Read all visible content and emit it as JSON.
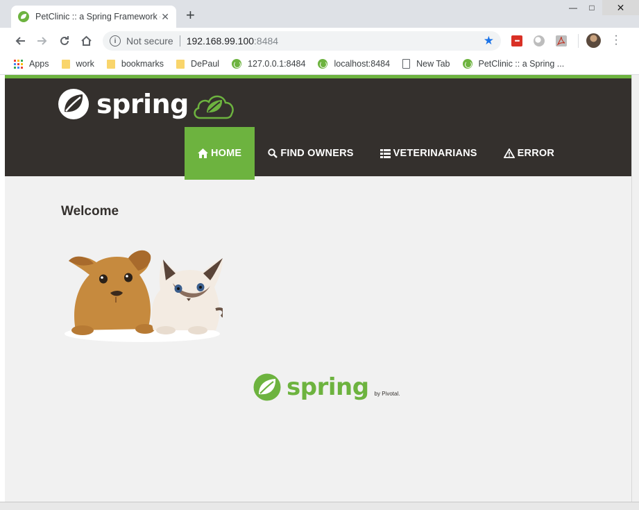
{
  "browser": {
    "tab_title": "PetClinic :: a Spring Framework d",
    "tab_close": "✕",
    "new_tab": "+",
    "window_controls": {
      "minimize": "—",
      "maximize": "□",
      "close": "✕"
    },
    "address": {
      "security": "Not secure",
      "host": "192.168.99.100",
      "port": ":8484"
    },
    "bookmarks": [
      {
        "label": "Apps",
        "icon": "apps-grid-icon"
      },
      {
        "label": "work",
        "icon": "folder-icon"
      },
      {
        "label": "bookmarks",
        "icon": "folder-icon"
      },
      {
        "label": "DePaul",
        "icon": "folder-icon"
      },
      {
        "label": "127.0.0.1:8484",
        "icon": "spring-leaf-icon"
      },
      {
        "label": "localhost:8484",
        "icon": "spring-leaf-icon"
      },
      {
        "label": "New Tab",
        "icon": "page-icon"
      },
      {
        "label": "PetClinic :: a Spring ...",
        "icon": "spring-leaf-icon"
      }
    ]
  },
  "page": {
    "brand": "spring",
    "nav": [
      {
        "label": "HOME",
        "icon": "home-icon",
        "active": true
      },
      {
        "label": "FIND OWNERS",
        "icon": "search-icon",
        "active": false
      },
      {
        "label": "VETERINARIANS",
        "icon": "list-icon",
        "active": false
      },
      {
        "label": "ERROR",
        "icon": "warning-icon",
        "active": false
      }
    ],
    "heading": "Welcome",
    "footer": {
      "word": "spring",
      "by": "by Pivotal."
    }
  },
  "colors": {
    "spring_green": "#6db33f",
    "nav_dark": "#34302d",
    "page_bg": "#f1f1f1"
  }
}
